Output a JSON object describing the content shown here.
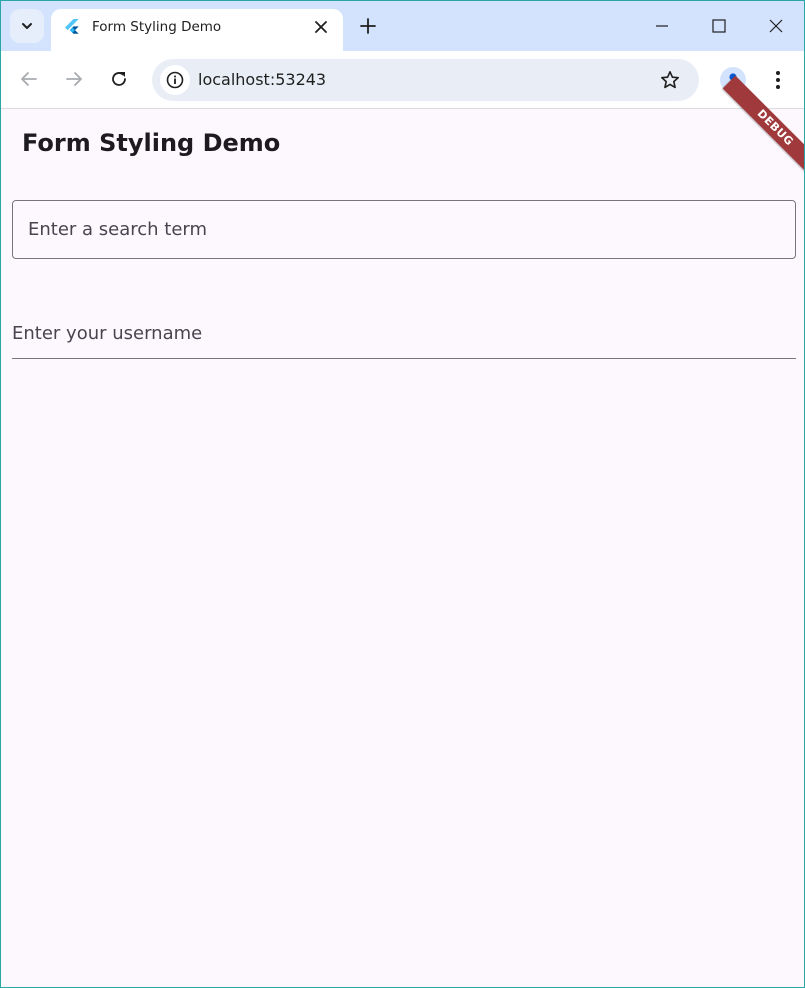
{
  "browser": {
    "tab": {
      "title": "Form Styling Demo"
    },
    "address_bar": {
      "url": "localhost:53243"
    },
    "icons": {
      "tab_search": "chevron-down-icon",
      "favicon": "flutter-icon",
      "tab_close": "close-icon",
      "new_tab": "plus-icon",
      "minimize": "minimize-icon",
      "maximize": "maximize-icon",
      "close": "close-icon",
      "back": "arrow-left-icon",
      "forward": "arrow-right-icon",
      "reload": "reload-icon",
      "site_info": "info-icon",
      "bookmark": "star-icon",
      "profile": "person-icon",
      "menu": "kebab-icon"
    }
  },
  "app": {
    "title": "Form Styling Demo",
    "debug_banner": "DEBUG",
    "search_field": {
      "placeholder": "Enter a search term",
      "value": ""
    },
    "username_field": {
      "placeholder": "Enter your username",
      "value": ""
    }
  },
  "colors": {
    "tabstrip_bg": "#d3e3fd",
    "page_bg": "#fdf7fe",
    "debug_banner": "#a0393c",
    "field_border": "#79747e"
  }
}
